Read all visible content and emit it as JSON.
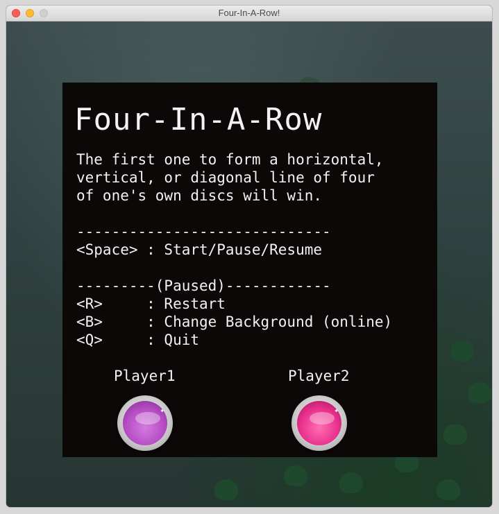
{
  "window": {
    "title": "Four-In-A-Row!"
  },
  "game": {
    "title": "Four-In-A-Row",
    "description": "The first one to form a horizontal,\nvertical, or diagonal line of four\nof one's own discs will win.",
    "controls": "-----------------------------\n<Space> : Start/Pause/Resume\n\n---------(Paused)------------\n<R>     : Restart\n<B>     : Change Background (online)\n<Q>     : Quit"
  },
  "players": [
    {
      "label": "Player1",
      "disc_color": "#b54cc3"
    },
    {
      "label": "Player2",
      "disc_color": "#e8308c"
    }
  ],
  "icons": {
    "close": "close-icon",
    "minimize": "minimize-icon",
    "maximize": "maximize-icon"
  }
}
